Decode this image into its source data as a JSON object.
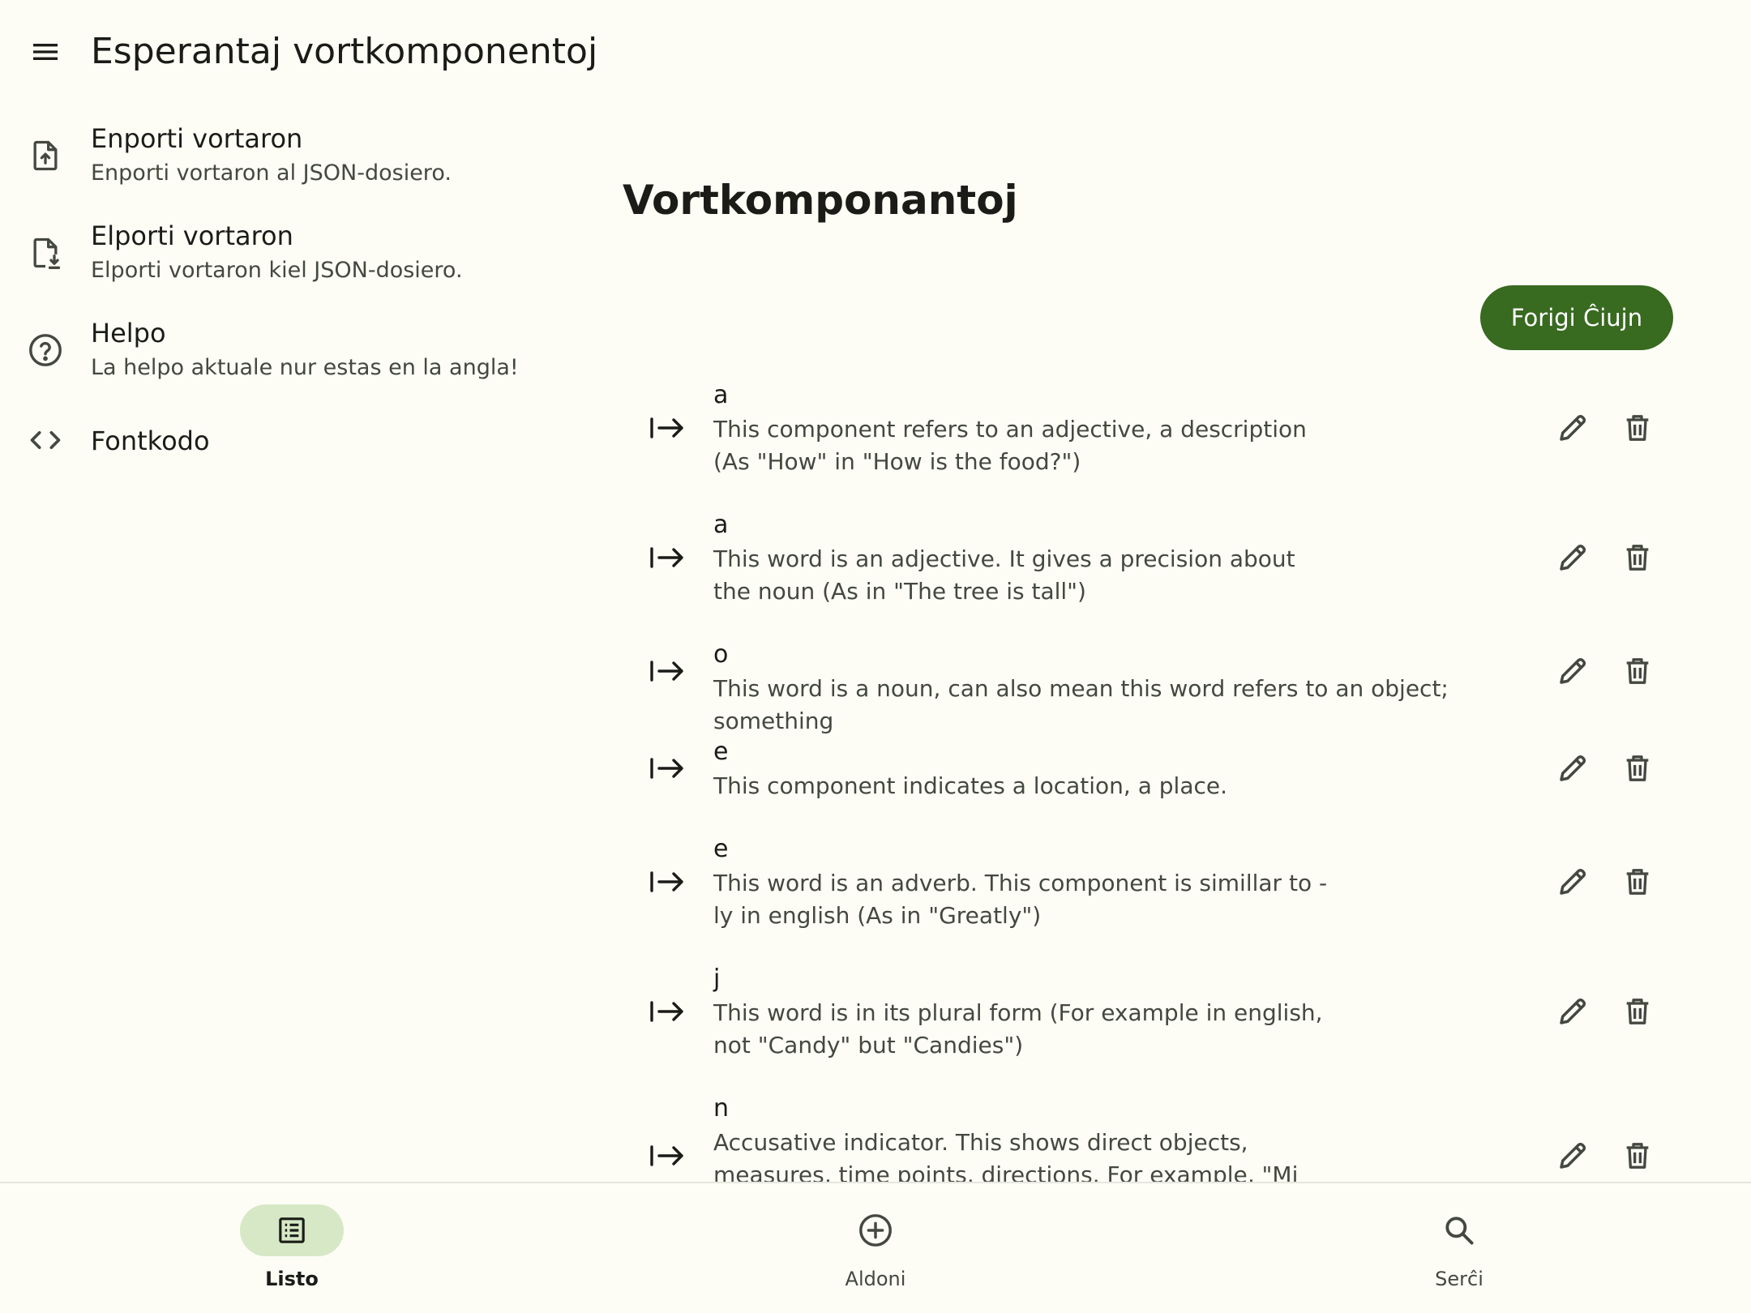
{
  "app_title": "Esperantaj vortkomponentoj",
  "drawer": {
    "items": [
      {
        "title": "Enporti vortaron",
        "subtitle": "Enporti vortaron al JSON-dosiero.",
        "icon": "file-upload-icon"
      },
      {
        "title": "Elporti vortaron",
        "subtitle": "Elporti vortaron kiel JSON-dosiero.",
        "icon": "file-download-icon"
      },
      {
        "title": "Helpo",
        "subtitle": "La helpo aktuale nur estas en la angla!",
        "icon": "help-circle-icon"
      },
      {
        "title": "Fontkodo",
        "subtitle": "",
        "icon": "code-icon"
      }
    ]
  },
  "main": {
    "title": "Vortkomponantoj",
    "delete_all_label": "Forigi Ĉiujn",
    "components": [
      {
        "component": "a",
        "description": "This component refers to an adjective, a description (As \"How\" in \"How is the food?\")"
      },
      {
        "component": "a",
        "description": "This word is an adjective. It gives a precision about the noun (As in \"The tree is tall\")"
      },
      {
        "component": "o",
        "description": "This word is a noun, can also mean this word refers to an object; something"
      },
      {
        "component": "e",
        "description": "This component indicates a location, a place."
      },
      {
        "component": "e",
        "description": "This word is an adverb. This component is simillar to -ly in english (As in \"Greatly\")"
      },
      {
        "component": "j",
        "description": "This word is in its plural form (For example in english, not \"Candy\" but \"Candies\")"
      },
      {
        "component": "n",
        "description": "Accusative indicator. This shows direct objects, measures, time points, directions. For example, \"Mi amas vin\" (\"I love you\"), \"vi\" is a direct object so"
      }
    ]
  },
  "bottom_nav": {
    "items": [
      {
        "label": "Listo",
        "icon": "list-icon",
        "active": true
      },
      {
        "label": "Aldoni",
        "icon": "add-circle-icon",
        "active": false
      },
      {
        "label": "Serĉi",
        "icon": "search-icon",
        "active": false
      }
    ]
  },
  "colors": {
    "background": "#fdfdf6",
    "primary": "#386a20",
    "nav_indicator": "#d6e8c6",
    "text": "#1b1c18",
    "text_secondary": "#44483e"
  }
}
